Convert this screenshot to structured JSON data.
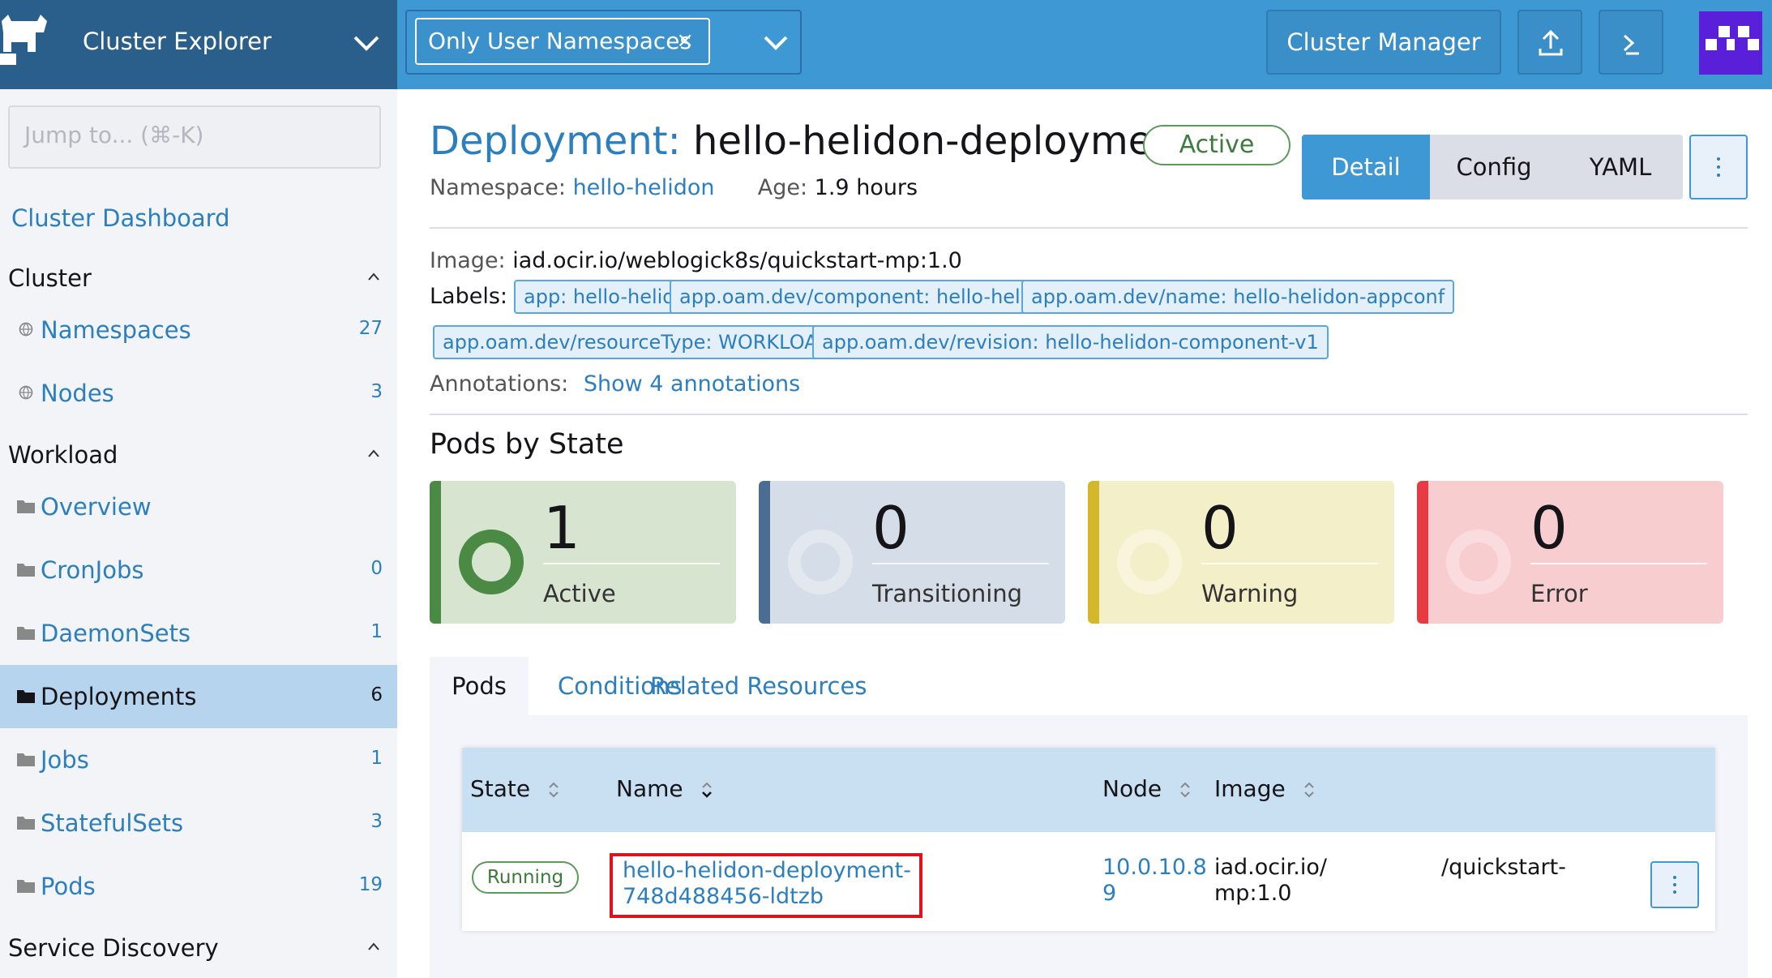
{
  "header": {
    "app_title": "Cluster Explorer",
    "namespace_filter": "Only User Namespaces",
    "namespace_filter_clear": "×",
    "cluster_manager_label": "Cluster Manager"
  },
  "sidebar": {
    "jump_placeholder": "Jump to... (⌘-K)",
    "dashboard_link": "Cluster Dashboard",
    "groups": {
      "cluster": "Cluster",
      "workload": "Workload",
      "service_discovery": "Service Discovery"
    },
    "items": [
      {
        "label": "Namespaces",
        "count": "27"
      },
      {
        "label": "Nodes",
        "count": "3"
      },
      {
        "label": "Overview",
        "count": ""
      },
      {
        "label": "CronJobs",
        "count": "0"
      },
      {
        "label": "DaemonSets",
        "count": "1"
      },
      {
        "label": "Deployments",
        "count": "6"
      },
      {
        "label": "Jobs",
        "count": "1"
      },
      {
        "label": "StatefulSets",
        "count": "3"
      },
      {
        "label": "Pods",
        "count": "19"
      }
    ]
  },
  "detail": {
    "kind": "Deployment:",
    "name": "hello-helidon-deployment",
    "status": "Active",
    "namespace_key": "Namespace:",
    "namespace_value": "hello-helidon",
    "age_key": "Age:",
    "age_value": "1.9 hours",
    "view_modes": [
      "Detail",
      "Config",
      "YAML"
    ],
    "image_key": "Image:",
    "image_value": "iad.ocir.io/weblogick8s/quickstart-mp:1.0",
    "labels_key": "Labels:",
    "labels": [
      "app: hello-helidon",
      "app.oam.dev/component: hello-helidon-component",
      "app.oam.dev/name: hello-helidon-appconf",
      "app.oam.dev/resourceType: WORKLOAD",
      "app.oam.dev/revision: hello-helidon-component-v1"
    ],
    "annotations_key": "Annotations:",
    "annotations_link": "Show 4 annotations"
  },
  "pods_by_state": {
    "title": "Pods by State",
    "states": [
      {
        "count": "1",
        "label": "Active",
        "color": "#4a8a44"
      },
      {
        "count": "0",
        "label": "Transitioning",
        "color": "#4c6d92"
      },
      {
        "count": "0",
        "label": "Warning",
        "color": "#d4b82c"
      },
      {
        "count": "0",
        "label": "Error",
        "color": "#e83a43"
      }
    ]
  },
  "tabs": [
    "Pods",
    "Conditions",
    "Related Resources"
  ],
  "pods_table": {
    "columns": [
      "State",
      "Name",
      "Node",
      "Image"
    ],
    "rows": [
      {
        "state": "Running",
        "name": "hello-helidon-deployment-748d488456-ldtzb",
        "node_line1": "10.0.10.8",
        "node_line2": "9",
        "image_line1": "iad.ocir.io/",
        "image_line2": "mp:1.0",
        "image_line3": "/quickstart-"
      }
    ]
  },
  "colors": {
    "brand_dark": "#2a5f8c",
    "header_blue": "#3d98d3",
    "link_blue": "#2c7fbf",
    "highlight_red": "#e0121e"
  }
}
